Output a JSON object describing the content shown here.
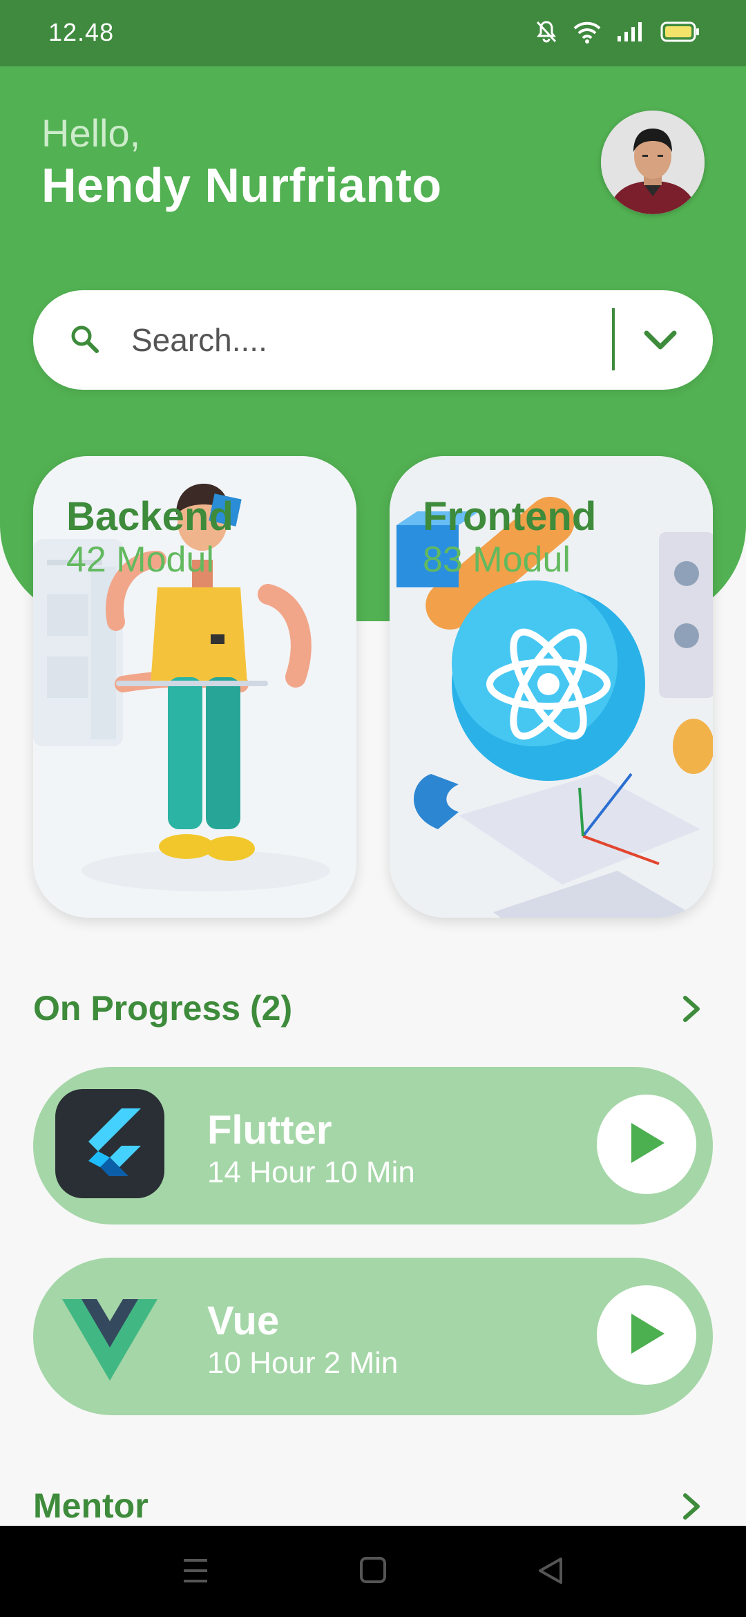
{
  "status_bar": {
    "time": "12.48"
  },
  "header": {
    "greeting": "Hello,",
    "user_name": "Hendy Nurfrianto"
  },
  "search": {
    "placeholder": "Search...."
  },
  "categories": [
    {
      "title": "Backend",
      "modules": "42 Modul"
    },
    {
      "title": "Frontend",
      "modules": "83 Modul"
    }
  ],
  "on_progress": {
    "title": "On Progress (2)",
    "courses": [
      {
        "name": "Flutter",
        "duration": "14 Hour 10 Min"
      },
      {
        "name": "Vue",
        "duration": "10 Hour 2 Min"
      }
    ]
  },
  "mentor": {
    "title": "Mentor"
  },
  "colors": {
    "primary": "#52b152",
    "primary_dark": "#3d8b3b",
    "status_bar": "#3f8a3e",
    "card_light": "#a5d6a7",
    "background": "#f6f7f6"
  },
  "icons": [
    "search-icon",
    "chevron-down-icon",
    "chevron-right-icon",
    "play-icon",
    "flutter-logo",
    "vue-logo",
    "menu-icon",
    "home-icon",
    "back-icon",
    "wifi-icon",
    "signal-icon",
    "battery-icon",
    "notifications-off-icon"
  ]
}
